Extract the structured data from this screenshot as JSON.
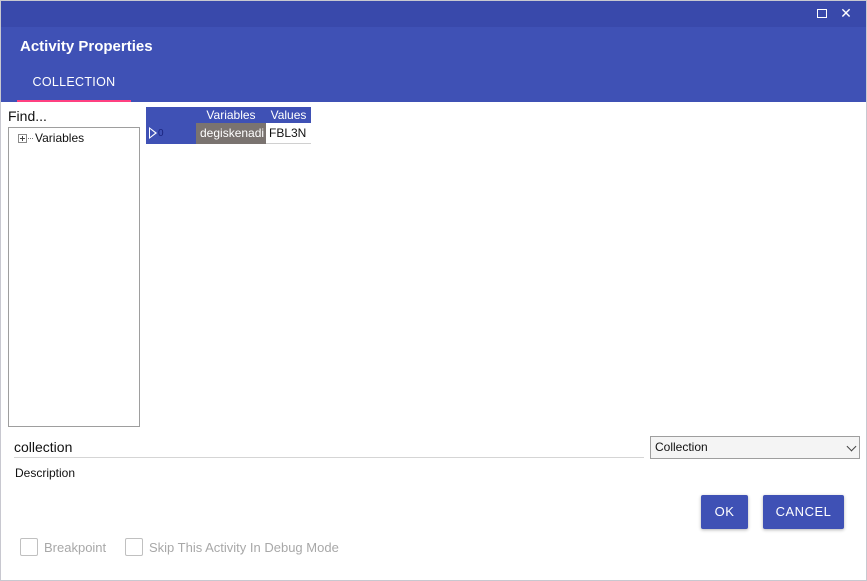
{
  "window": {
    "maximize_icon": "maximize-icon",
    "close_icon": "close-icon",
    "close_glyph": "✕"
  },
  "header": {
    "title": "Activity Properties",
    "tabs": [
      {
        "label": "COLLECTION",
        "active": true
      }
    ]
  },
  "sidebar": {
    "find_placeholder": "Find...",
    "tree": [
      {
        "label": "Variables",
        "expanded": false
      }
    ]
  },
  "grid": {
    "columns": [
      "Variables",
      "Values"
    ],
    "rows": [
      {
        "index": "0",
        "variable": "degiskenadi",
        "value": "FBL3N"
      }
    ]
  },
  "form": {
    "name_value": "collection",
    "type_selected": "Collection",
    "description_label": "Description"
  },
  "buttons": {
    "ok": "OK",
    "cancel": "CANCEL"
  },
  "options": {
    "breakpoint": "Breakpoint",
    "skip_debug": "Skip This Activity In Debug Mode"
  },
  "colors": {
    "primary": "#3f51b5",
    "titlebar": "#3949ab",
    "tab_indicator": "#ff4081",
    "selected_cell": "#7a7370"
  }
}
